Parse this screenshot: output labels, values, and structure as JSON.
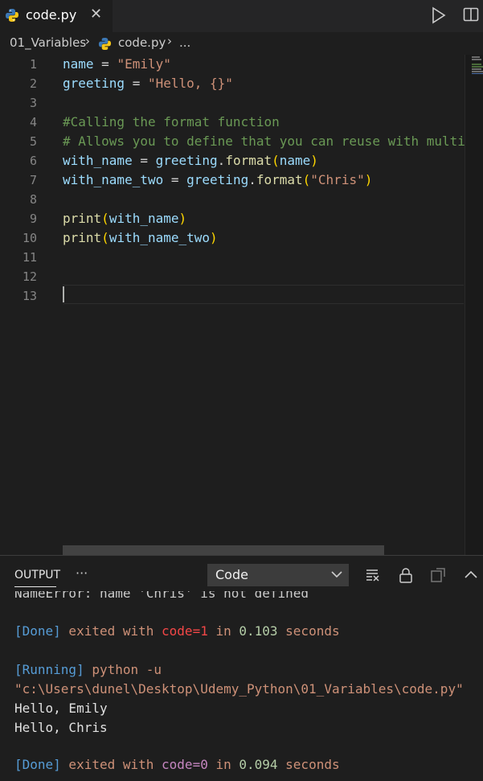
{
  "tab": {
    "title": "code.py",
    "close": "✕"
  },
  "breadcrumb": {
    "folder": "01_Variables",
    "sep": "›",
    "file": "code.py",
    "more": "..."
  },
  "line_numbers": [
    "1",
    "2",
    "3",
    "4",
    "5",
    "6",
    "7",
    "8",
    "9",
    "10",
    "11",
    "12",
    "13"
  ],
  "code": {
    "l1": {
      "a": "name",
      "b": " = ",
      "c": "\"Emily\""
    },
    "l2": {
      "a": "greeting",
      "b": " = ",
      "c": "\"Hello, {}\""
    },
    "l4": "#Calling the format function",
    "l5": "# Allows you to define that you can reuse with multi",
    "l6": {
      "a": "with_name",
      "b": " = ",
      "c": "greeting",
      "d": ".",
      "e": "format",
      "f": "(",
      "g": "name",
      "h": ")"
    },
    "l7": {
      "a": "with_name_two",
      "b": " = ",
      "c": "greeting",
      "d": ".",
      "e": "format",
      "f": "(",
      "g": "\"Chris\"",
      "h": ")"
    },
    "l9": {
      "a": "print",
      "b": "(",
      "c": "with_name",
      "d": ")"
    },
    "l10": {
      "a": "print",
      "b": "(",
      "c": "with_name_two",
      "d": ")"
    }
  },
  "panel": {
    "tab_label": "OUTPUT",
    "more": "···",
    "channel": "Code"
  },
  "output": {
    "o1": "NameError: name 'Chris' is not defined",
    "o2": {
      "done": "[Done]",
      "a": " exited with ",
      "code": "code=1",
      "b": " in ",
      "t": "0.103",
      "c": " seconds"
    },
    "o3": {
      "running": "[Running]",
      "cmd": " python -u"
    },
    "o4": "\"c:\\Users\\dunel\\Desktop\\Udemy_Python\\01_Variables\\code.py\"",
    "o5": "Hello, Emily",
    "o6": "Hello, Chris",
    "o7": {
      "done": "[Done]",
      "a": " exited with ",
      "code": "code=0",
      "b": " in ",
      "t": "0.094",
      "c": " seconds"
    }
  },
  "icons": {
    "python": "python-file-icon",
    "run": "run-icon",
    "split": "split-editor-icon",
    "clear": "clear-output-icon",
    "lock": "lock-icon",
    "copy": "open-output-icon",
    "collapse": "chevron-up-icon"
  }
}
